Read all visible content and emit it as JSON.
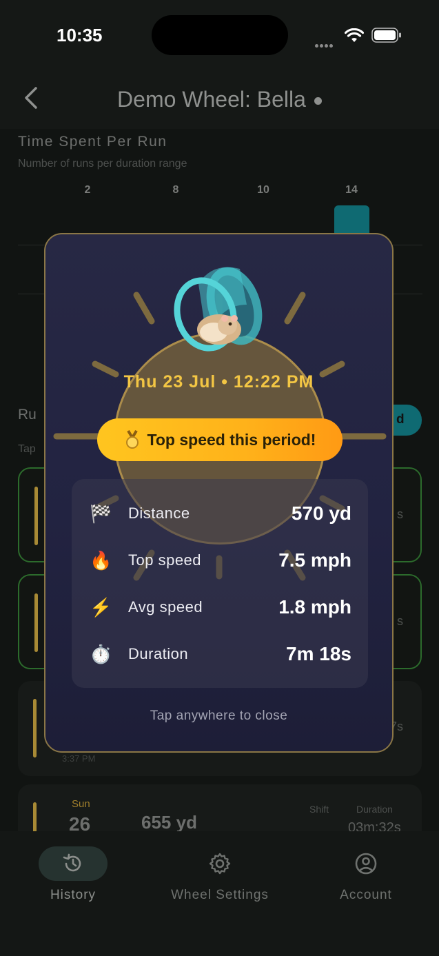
{
  "status_bar": {
    "time": "10:35"
  },
  "nav": {
    "title": "Demo Wheel: Bella"
  },
  "chart_section": {
    "title": "Time Spent Per Run",
    "subtitle": "Number of runs per duration range"
  },
  "chart_data": {
    "type": "bar",
    "categories": [
      "",
      "",
      "",
      ""
    ],
    "values": [
      2,
      8,
      10,
      14
    ],
    "title": "Time Spent Per Run",
    "subtitle": "Number of runs per duration range"
  },
  "runs_section": {
    "title_partial": "Ru",
    "subtitle_partial": "Tap",
    "pill_partial": "d"
  },
  "background_list": {
    "last_item": {
      "day": "Sun",
      "date": "26",
      "distance": "655 yd",
      "shift_label": "Shift",
      "duration_label": "Duration",
      "duration": "03m:32s"
    },
    "partial_time": "3:37 PM",
    "partial_right": [
      "s",
      "s",
      "7s"
    ]
  },
  "modal": {
    "datetime": "Thu 23 Jul  •  12:22 PM",
    "badge": "Top speed this period!",
    "stats": [
      {
        "icon": "checkered-flag-icon",
        "emoji": "🏁",
        "label": "Distance",
        "value": "570 yd"
      },
      {
        "icon": "fire-icon",
        "emoji": "🔥",
        "label": "Top speed",
        "value": "7.5 mph"
      },
      {
        "icon": "lightning-icon",
        "emoji": "⚡",
        "label": "Avg speed",
        "value": "1.8 mph"
      },
      {
        "icon": "stopwatch-icon",
        "emoji": "⏱️",
        "label": "Duration",
        "value": "7m 18s"
      }
    ],
    "close_hint": "Tap anywhere to close"
  },
  "tabs": [
    {
      "label": "History",
      "icon": "history-icon",
      "active": true
    },
    {
      "label": "Wheel Settings",
      "icon": "gear-icon",
      "active": false
    },
    {
      "label": "Account",
      "icon": "account-icon",
      "active": false
    }
  ],
  "colors": {
    "accent_teal": "#0f6a72",
    "gold": "#f3c644",
    "badge_orange": "#ff9a14",
    "modal_bg": "#232440"
  }
}
